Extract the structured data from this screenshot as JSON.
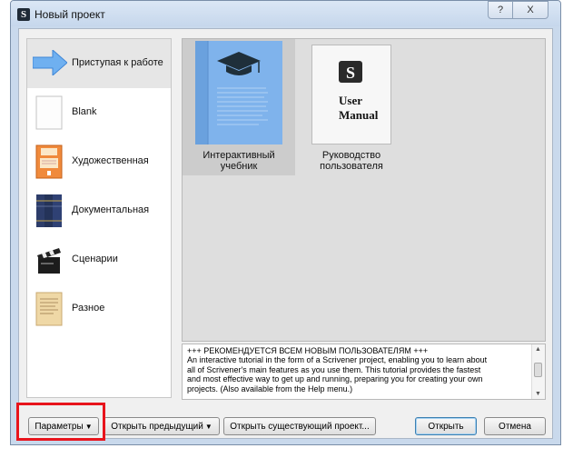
{
  "window": {
    "title": "Новый проект",
    "help_glyph": "?",
    "close_glyph": "X"
  },
  "categories": [
    {
      "label": "Приступая к работе",
      "icon": "arrow-right-icon",
      "selected": true
    },
    {
      "label": "Blank",
      "icon": "blank-page-icon"
    },
    {
      "label": "Художественная",
      "icon": "notebook-icon"
    },
    {
      "label": "Документальная",
      "icon": "books-icon"
    },
    {
      "label": "Сценарии",
      "icon": "clapperboard-icon"
    },
    {
      "label": "Разное",
      "icon": "parchment-icon"
    }
  ],
  "templates": [
    {
      "line1": "Интерактивный",
      "line2": "учебник",
      "icon": "graduation-cap-icon",
      "selected": true
    },
    {
      "line1": "Руководство",
      "line2": "пользователя",
      "icon": "user-manual-icon",
      "book_text1": "User",
      "book_text2": "Manual",
      "logo_letter": "S"
    }
  ],
  "description": [
    "+++ РЕКОМЕНДУЕТСЯ ВСЕМ НОВЫМ ПОЛЬЗОВАТЕЛЯМ +++",
    "An interactive tutorial in the form of a Scrivener project, enabling you to learn about",
    "all of Scrivener's main features as you use them. This tutorial provides the fastest",
    "and most effective way to get up and running, preparing you for creating your own",
    "projects. (Also available from the Help menu.)"
  ],
  "buttons": {
    "options": "Параметры",
    "open_recent": "Открыть предыдущий",
    "open_existing": "Открыть существующий проект...",
    "open": "Открыть",
    "cancel": "Отмена",
    "dropdown_arrow": "▼"
  },
  "colors": {
    "highlight": "#e8141c",
    "selection": "#e6e6e6",
    "accent_blue": "#5a9ee8"
  }
}
